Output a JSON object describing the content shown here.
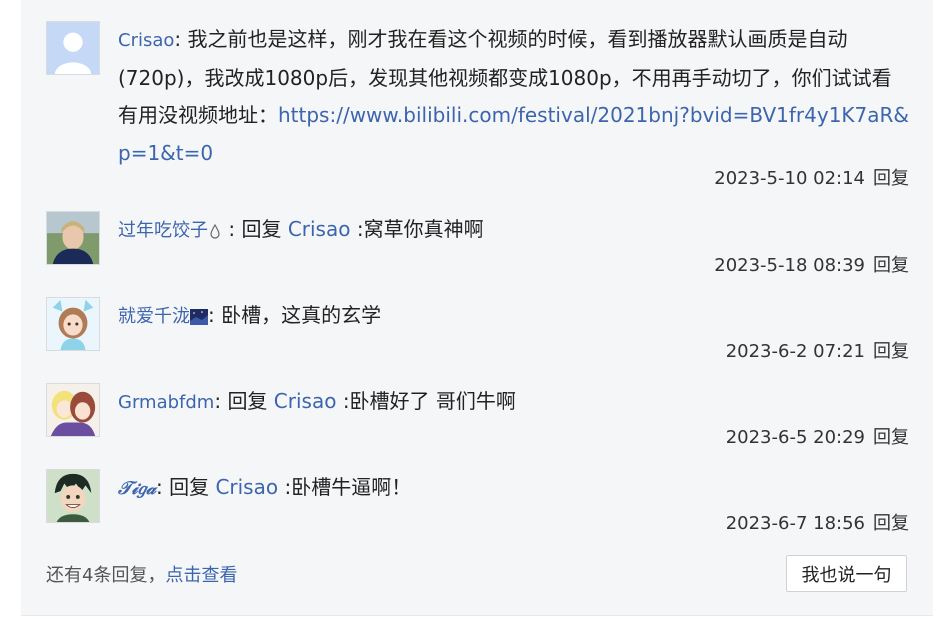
{
  "replies": [
    {
      "user": "Crisao",
      "avatar_icon": "default-user-avatar",
      "content": "我之前也是这样，刚才我在看这个视频的时候，看到播放器默认画质是自动(720p)，我改成1080p后，发现其他视频都变成1080p，不用再手动切了，你们试试看有用没视频地址：",
      "link": "https://www.bilibili.com/festival/2021bnj?bvid=BV1fr4y1K7aR&p=1&t=0",
      "time": "2023-5-10 02:14",
      "reply_label": "回复"
    },
    {
      "user": "过年吃饺子",
      "avatar_icon": "person-photo-avatar",
      "badge_icon": "drop-icon",
      "reply_prefix": "回复",
      "mention": "Crisao",
      "content": ":窝草你真神啊",
      "time": "2023-5-18 08:39",
      "reply_label": "回复"
    },
    {
      "user": "就爱千泷",
      "avatar_icon": "anime-girl-avatar",
      "badge_icon": "night-sky-icon",
      "content": "卧槽，这真的玄学",
      "time": "2023-6-2 07:21",
      "reply_label": "回复"
    },
    {
      "user": "Grmabfdm",
      "avatar_icon": "anime-couple-avatar",
      "reply_prefix": "回复",
      "mention": "Crisao",
      "content": ":卧槽好了 哥们牛啊",
      "time": "2023-6-5 20:29",
      "reply_label": "回复"
    },
    {
      "user": "𝒯𝒾𝑔𝒶",
      "avatar_icon": "anime-boy-avatar",
      "reply_prefix": "回复",
      "mention": "Crisao",
      "content": ":卧槽牛逼啊！",
      "time": "2023-6-7 18:56",
      "reply_label": "回复"
    }
  ],
  "footer": {
    "more_count_text": "还有4条回复，",
    "more_link": "点击查看",
    "say_button": "我也说一句"
  },
  "colors": {
    "link": "#3c65ad",
    "panel_bg": "#f5f6f8"
  }
}
